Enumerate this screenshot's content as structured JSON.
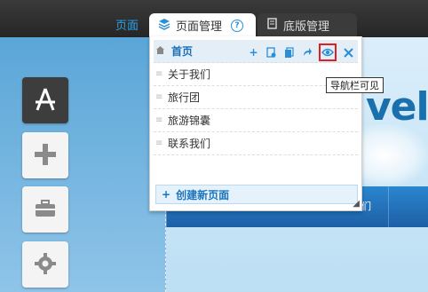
{
  "topbar": {
    "link_label": "页面",
    "tabs": [
      {
        "label": "页面管理",
        "active": true
      },
      {
        "label": "底版管理",
        "active": false
      }
    ],
    "help_symbol": "?"
  },
  "sidebar_tools": [
    {
      "icon": "app-store-icon",
      "style": "dark"
    },
    {
      "icon": "plus-icon",
      "style": "light"
    },
    {
      "icon": "toolbox-icon",
      "style": "light"
    },
    {
      "icon": "gear-icon",
      "style": "light"
    }
  ],
  "panel": {
    "home": {
      "label": "首页"
    },
    "pages": [
      "关于我们",
      "旅行团",
      "旅游锦囊",
      "联系我们"
    ],
    "create_label": "创建新页面"
  },
  "tooltip": "导航栏可见",
  "preview": {
    "logo_fragment": "vel",
    "nav_fragment": "们"
  },
  "colors": {
    "accent": "#2a8fd6",
    "highlight_border": "#e02020",
    "topbar": "#2e2e2e"
  }
}
